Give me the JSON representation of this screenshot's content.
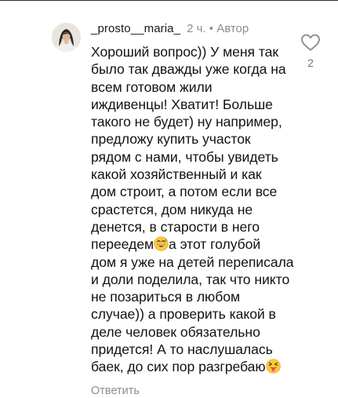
{
  "comment": {
    "username": "_prosto__maria_",
    "time": "2 ч.",
    "separator": "•",
    "author_badge": "Автор",
    "text_part1": "Хороший вопрос)) У меня так\nбыло так дважды уже когда на\nвсем готовом жили\nиждивенцы! Хватит! Больше\nтакого не будет) ну например,\nпредложу купить участок\nрядом с нами, чтобы увидеть\nкакой хозяйственный и как\nдом строит, а потом если все\nсрастется, дом никуда не\nденется, в старости в него\nпереедем",
    "emoji1": "grinning-sweat-emoji",
    "text_part2": "а этот голубой\nдом я уже на детей переписала\nи доли поделила, так что никто\nне позариться в любом\nслучае)) а проверить какой в\nделе человек обязательно\nпридется! А то наслушалась\nбаек, до сих пор разгребаю",
    "emoji2": "squinting-tongue-emoji",
    "reply_label": "Ответить",
    "like_count": "2",
    "like_icon": "heart-outline-icon"
  },
  "colors": {
    "text": "#121212",
    "muted": "#8e8e8e",
    "background": "#ffffff"
  }
}
